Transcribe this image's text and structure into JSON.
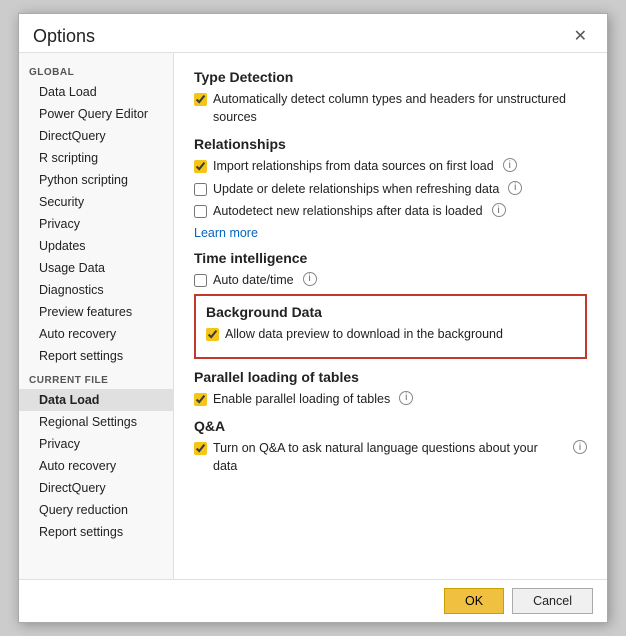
{
  "dialog": {
    "title": "Options",
    "close_label": "✕"
  },
  "sidebar": {
    "global_label": "GLOBAL",
    "global_items": [
      {
        "label": "Data Load",
        "active": false
      },
      {
        "label": "Power Query Editor",
        "active": false
      },
      {
        "label": "DirectQuery",
        "active": false
      },
      {
        "label": "R scripting",
        "active": false
      },
      {
        "label": "Python scripting",
        "active": false
      },
      {
        "label": "Security",
        "active": false
      },
      {
        "label": "Privacy",
        "active": false
      },
      {
        "label": "Updates",
        "active": false
      },
      {
        "label": "Usage Data",
        "active": false
      },
      {
        "label": "Diagnostics",
        "active": false
      },
      {
        "label": "Preview features",
        "active": false
      },
      {
        "label": "Auto recovery",
        "active": false
      },
      {
        "label": "Report settings",
        "active": false
      }
    ],
    "current_file_label": "CURRENT FILE",
    "current_file_items": [
      {
        "label": "Data Load",
        "active": true
      },
      {
        "label": "Regional Settings",
        "active": false
      },
      {
        "label": "Privacy",
        "active": false
      },
      {
        "label": "Auto recovery",
        "active": false
      },
      {
        "label": "DirectQuery",
        "active": false
      },
      {
        "label": "Query reduction",
        "active": false
      },
      {
        "label": "Report settings",
        "active": false
      }
    ]
  },
  "main": {
    "sections": [
      {
        "id": "type-detection",
        "title": "Type Detection",
        "items": [
          {
            "id": "auto-detect",
            "label": "Automatically detect column types and headers for unstructured sources",
            "checked": true,
            "has_info": false
          }
        ]
      },
      {
        "id": "relationships",
        "title": "Relationships",
        "items": [
          {
            "id": "import-relationships",
            "label": "Import relationships from data sources on first load",
            "checked": true,
            "has_info": true
          },
          {
            "id": "update-delete-relationships",
            "label": "Update or delete relationships when refreshing data",
            "checked": false,
            "has_info": true
          },
          {
            "id": "autodetect-relationships",
            "label": "Autodetect new relationships after data is loaded",
            "checked": false,
            "has_info": true
          }
        ],
        "learn_more": "Learn more"
      },
      {
        "id": "time-intelligence",
        "title": "Time intelligence",
        "items": [
          {
            "id": "auto-date-time",
            "label": "Auto date/time",
            "checked": false,
            "has_info": true
          }
        ]
      },
      {
        "id": "background-data",
        "title": "Background Data",
        "highlighted": true,
        "items": [
          {
            "id": "allow-background-preview",
            "label": "Allow data preview to download in the background",
            "checked": true,
            "has_info": false
          }
        ]
      },
      {
        "id": "parallel-loading",
        "title": "Parallel loading of tables",
        "items": [
          {
            "id": "enable-parallel",
            "label": "Enable parallel loading of tables",
            "checked": true,
            "has_info": true
          }
        ]
      },
      {
        "id": "qna",
        "title": "Q&A",
        "items": [
          {
            "id": "turn-on-qna",
            "label": "Turn on Q&A to ask natural language questions about your data",
            "checked": true,
            "has_info": true
          }
        ]
      }
    ]
  },
  "footer": {
    "ok_label": "OK",
    "cancel_label": "Cancel"
  }
}
